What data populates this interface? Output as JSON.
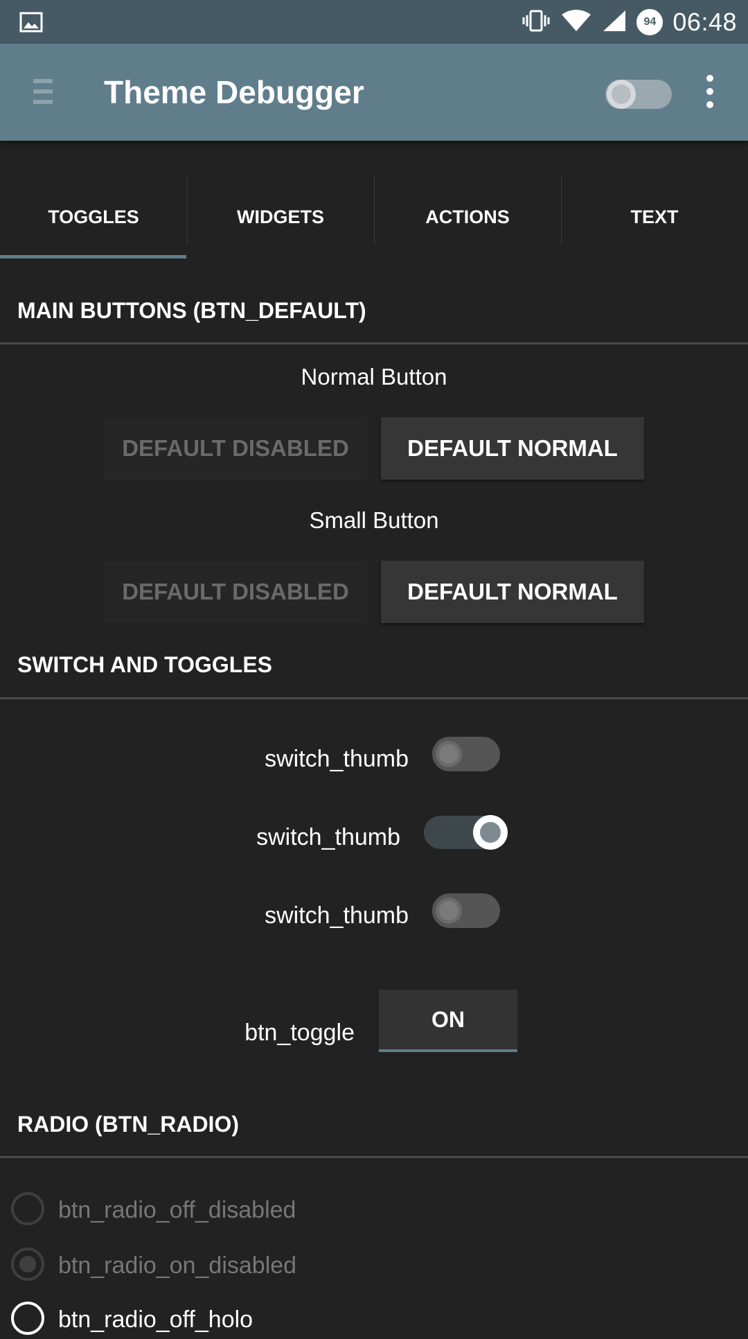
{
  "status_bar": {
    "time": "06:48",
    "battery": "94",
    "icons": [
      "image-icon",
      "vibrate-icon",
      "wifi-icon",
      "signal-icon",
      "battery-icon"
    ]
  },
  "toolbar": {
    "title": "Theme Debugger",
    "switch_state": "off",
    "icons": [
      "menu-icon",
      "overflow-menu-icon"
    ]
  },
  "tabs": [
    {
      "label": "TOGGLES",
      "selected": true
    },
    {
      "label": "WIDGETS",
      "selected": false
    },
    {
      "label": "ACTIONS",
      "selected": false
    },
    {
      "label": "TEXT",
      "selected": false
    }
  ],
  "main_buttons": {
    "header": "MAIN BUTTONS (BTN_DEFAULT)",
    "normal_label": "Normal Button",
    "small_label": "Small Button",
    "disabled_label": "DEFAULT DISABLED",
    "normal_button_label": "DEFAULT NORMAL"
  },
  "switches": {
    "header": "SWITCH AND TOGGLES",
    "items": [
      {
        "label": "switch_thumb",
        "state": "off"
      },
      {
        "label": "switch_thumb",
        "state": "on"
      },
      {
        "label": "switch_thumb",
        "state": "off"
      }
    ],
    "toggle_label": "btn_toggle",
    "toggle_value": "ON"
  },
  "radio": {
    "header": "RADIO (BTN_RADIO)",
    "items": [
      {
        "label": "btn_radio_off_disabled",
        "checked": false,
        "enabled": false
      },
      {
        "label": "btn_radio_on_disabled",
        "checked": true,
        "enabled": false
      },
      {
        "label": "btn_radio_off_holo",
        "checked": false,
        "enabled": true
      }
    ]
  },
  "colors": {
    "status_bar": "#455a64",
    "toolbar": "#607d8b",
    "background": "#222222",
    "accent": "#607d8b"
  }
}
